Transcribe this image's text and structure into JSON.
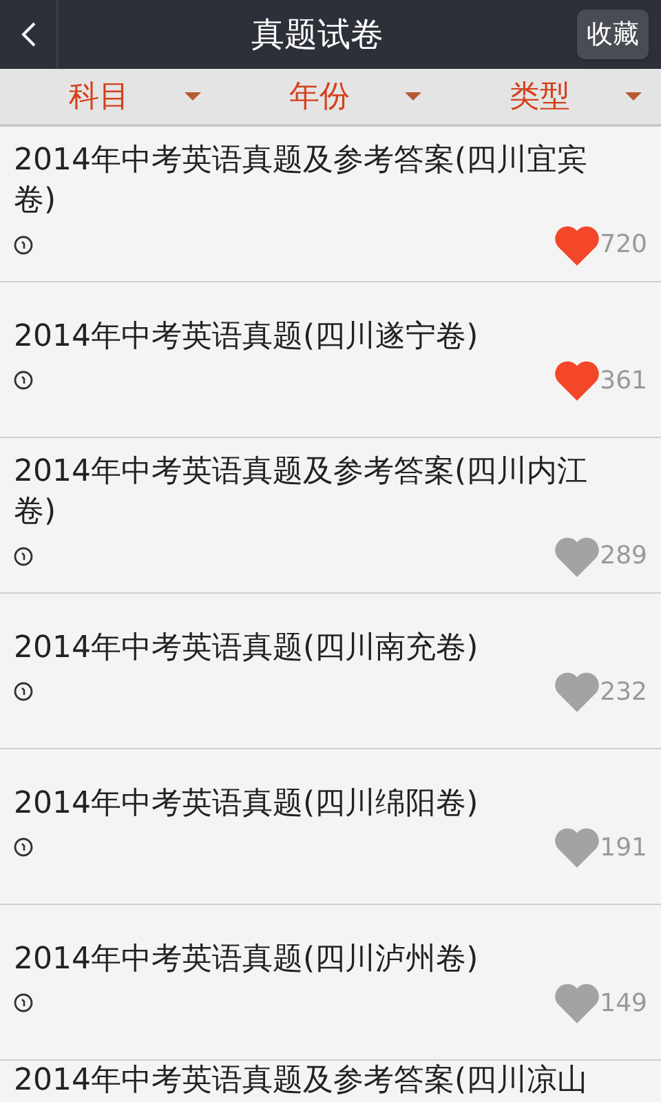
{
  "header": {
    "title": "真题试卷",
    "action": "收藏"
  },
  "filters": [
    {
      "label": "科目"
    },
    {
      "label": "年份"
    },
    {
      "label": "类型"
    }
  ],
  "papers": [
    {
      "title": "2014年中考英语真题及参考答案(四川宜宾卷)",
      "favorited": true,
      "count": "720"
    },
    {
      "title": "2014年中考英语真题(四川遂宁卷)",
      "favorited": true,
      "count": "361"
    },
    {
      "title": "2014年中考英语真题及参考答案(四川内江卷)",
      "favorited": false,
      "count": "289"
    },
    {
      "title": "2014年中考英语真题(四川南充卷)",
      "favorited": false,
      "count": "232"
    },
    {
      "title": "2014年中考英语真题(四川绵阳卷)",
      "favorited": false,
      "count": "191"
    },
    {
      "title": "2014年中考英语真题(四川泸州卷)",
      "favorited": false,
      "count": "149"
    }
  ],
  "next_paper": {
    "title": "2014年中考英语真题及参考答案(四川凉山"
  }
}
